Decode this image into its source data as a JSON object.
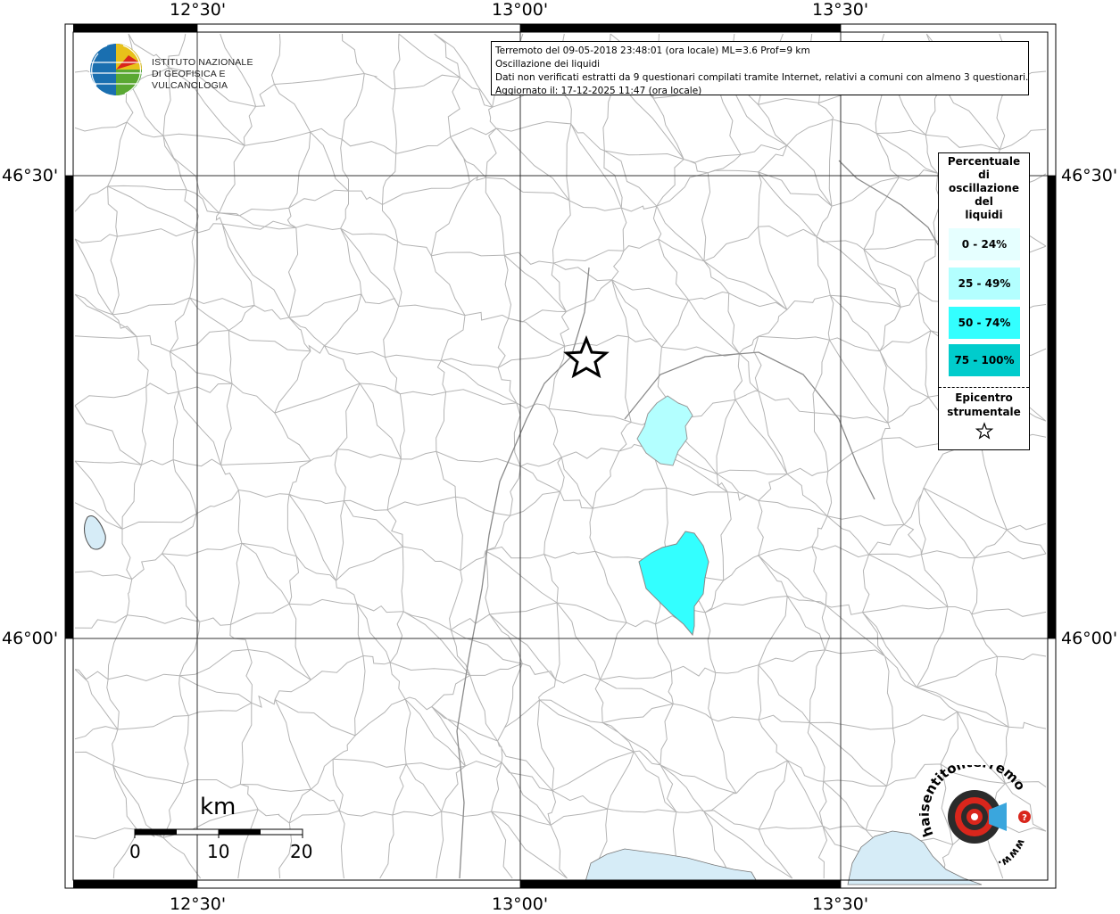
{
  "map": {
    "lon_labels": [
      "12°30'",
      "13°00'",
      "13°30'"
    ],
    "lat_labels": [
      "46°30'",
      "46°00'"
    ],
    "colors": {
      "boundary": "#b4b4b4",
      "frame": "#000000",
      "water": "#d6ecf7",
      "class_0_24": "#e6ffff",
      "class_25_49": "#b3ffff",
      "class_50_74": "#33ffff",
      "class_75_100": "#00cccc"
    }
  },
  "institute": {
    "line1": "ISTITUTO NAZIONALE",
    "line2": "DI GEOFISICA E VULCANOLOGIA"
  },
  "info": {
    "line1": "Terremoto del 09-05-2018 23:48:01 (ora locale) ML=3.6 Prof=9 km",
    "line2": "Oscillazione dei liquidi",
    "line3": "Dati non verificati estratti da 9 questionari compilati tramite Internet, relativi a comuni con almeno 3 questionari.",
    "line4": "Aggiornato il: 17-12-2025 11:47 (ora locale)"
  },
  "legend": {
    "title_lines": [
      "Percentuale",
      "di",
      "oscillazione",
      "del",
      "liquidi"
    ],
    "classes": [
      {
        "label": "0 - 24%",
        "color": "#e6ffff"
      },
      {
        "label": "25 - 49%",
        "color": "#b3ffff"
      },
      {
        "label": "50 - 74%",
        "color": "#33ffff"
      },
      {
        "label": "75 - 100%",
        "color": "#00cccc"
      }
    ],
    "epicenter_line1": "Epicentro",
    "epicenter_line2": "strumentale",
    "epicenter_icon": "star-outline-icon"
  },
  "scale": {
    "unit": "km",
    "ticks": [
      "0",
      "10",
      "20"
    ]
  },
  "brand": {
    "text": "haisentitoilterremoto.it",
    "url_text": "www."
  }
}
